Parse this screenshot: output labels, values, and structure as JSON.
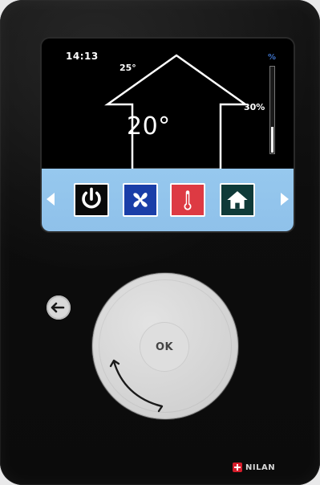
{
  "screen": {
    "time": "14:13",
    "outdoor_temperature": "25°",
    "indoor_temperature": "20°",
    "ventilation_percent": "30%",
    "ventilation_level": 0.3
  },
  "menu": {
    "items": [
      {
        "icon": "power-icon"
      },
      {
        "icon": "fan-icon"
      },
      {
        "icon": "thermometer-icon"
      },
      {
        "icon": "home-icon"
      }
    ],
    "left_arrow_icon": "arrow-left-icon",
    "right_arrow_icon": "arrow-right-icon"
  },
  "controls": {
    "back_icon": "back-icon",
    "ok_label": "OK",
    "rotate_icon": "rotate-arrows-icon"
  },
  "brand": {
    "name": "NILAN",
    "mark_icon": "nilan-logo-icon"
  },
  "colors": {
    "menu_bar": "#8fc1ea",
    "fan_tile": "#1a3ea8",
    "temp_tile": "#dd3a43",
    "home_tile": "#0f3a38",
    "level_indicator": "#3e72c8",
    "brand_mark": "#d51d2b"
  }
}
